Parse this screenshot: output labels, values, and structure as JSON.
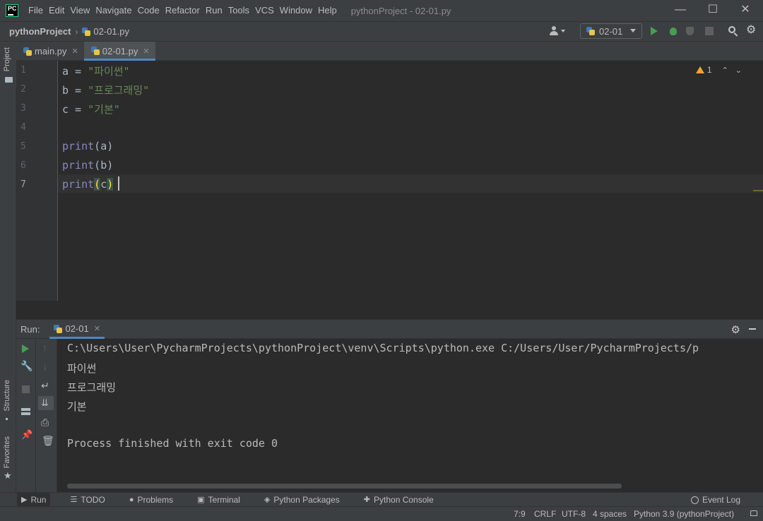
{
  "app": {
    "logo_text": "PC",
    "window_title": "pythonProject - 02-01.py",
    "menu": [
      "File",
      "Edit",
      "View",
      "Navigate",
      "Code",
      "Refactor",
      "Run",
      "Tools",
      "VCS",
      "Window",
      "Help"
    ],
    "window_controls": {
      "minimize": "—",
      "maximize": "☐",
      "close": "✕"
    }
  },
  "navbar": {
    "project": "pythonProject",
    "file": "02-01.py",
    "run_config": "02-01",
    "icons": [
      "user-icon",
      "run-icon",
      "debug-icon",
      "coverage-icon",
      "stop-icon",
      "search-icon",
      "settings-icon"
    ]
  },
  "left_strip": {
    "project_label": "Project",
    "structure_label": "Structure",
    "favorites_label": "Favorites"
  },
  "editor": {
    "tabs": [
      {
        "label": "main.py",
        "active": false
      },
      {
        "label": "02-01.py",
        "active": true
      }
    ],
    "line_numbers": [
      "1",
      "2",
      "3",
      "4",
      "5",
      "6",
      "7"
    ],
    "current_line": 7,
    "lines": [
      {
        "var": "a",
        "op": " = ",
        "str": "\"파이썬\""
      },
      {
        "var": "b",
        "op": " = ",
        "str": "\"프로그래밍\""
      },
      {
        "var": "c",
        "op": " = ",
        "str": "\"기본\""
      },
      {
        "blank": ""
      },
      {
        "fn": "print",
        "open": "(",
        "arg": "a",
        "close": ")"
      },
      {
        "fn": "print",
        "open": "(",
        "arg": "b",
        "close": ")"
      },
      {
        "fn": "print",
        "open": "(",
        "arg": "c",
        "close": ")"
      }
    ],
    "inspection": {
      "warnings": "1",
      "up": "⌃",
      "down": "⌄"
    }
  },
  "run_panel": {
    "label": "Run:",
    "tab": "02-01",
    "output": [
      "C:\\Users\\User\\PycharmProjects\\pythonProject\\venv\\Scripts\\python.exe C:/Users/User/PycharmProjects/p",
      "파이썬",
      "프로그래밍",
      "기본",
      "",
      "Process finished with exit code 0"
    ]
  },
  "bottom_tools": [
    {
      "label": "Run",
      "icon": "play-icon",
      "active": true
    },
    {
      "label": "TODO",
      "icon": "list-icon",
      "active": false
    },
    {
      "label": "Problems",
      "icon": "info-icon",
      "active": false
    },
    {
      "label": "Terminal",
      "icon": "terminal-icon",
      "active": false
    },
    {
      "label": "Python Packages",
      "icon": "layers-icon",
      "active": false
    },
    {
      "label": "Python Console",
      "icon": "python-icon",
      "active": false
    }
  ],
  "event_log": "Event Log",
  "status": {
    "position": "7:9",
    "line_sep": "CRLF",
    "encoding": "UTF-8",
    "indent": "4 spaces",
    "interpreter": "Python 3.9 (pythonProject)"
  }
}
